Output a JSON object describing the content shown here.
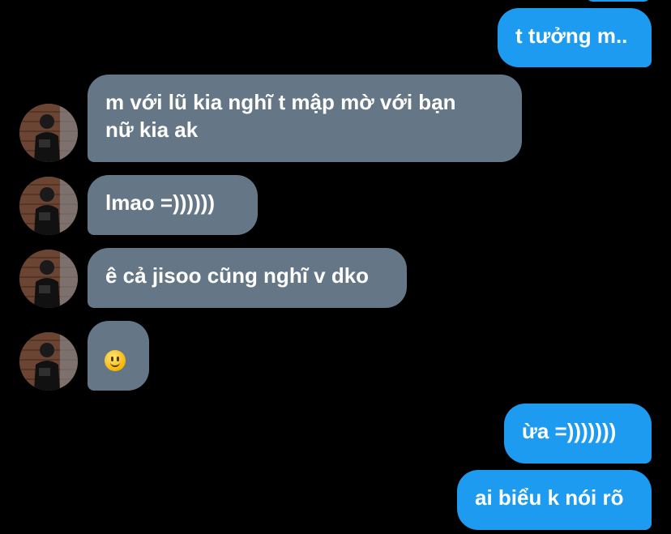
{
  "conversation": {
    "messages": [
      {
        "sender": "me",
        "text": "t tưởng m.."
      },
      {
        "sender": "them",
        "text_line1": "m với lũ kia nghĩ t mập mờ với bạn",
        "text_line2": "nữ kia ak"
      },
      {
        "sender": "them",
        "text": "lmao =))))))"
      },
      {
        "sender": "them",
        "text": "ê cả jisoo cũng nghĩ v dko"
      },
      {
        "sender": "them",
        "emoji": "slightly-smiling-face-icon"
      },
      {
        "sender": "me",
        "text": "ừa =)))))))"
      },
      {
        "sender": "me",
        "text": "ai biểu k nói rõ"
      }
    ]
  },
  "colors": {
    "background": "#000000",
    "sent_bubble": "#1d9bf0",
    "received_bubble": "#657786",
    "text": "#ffffff"
  }
}
